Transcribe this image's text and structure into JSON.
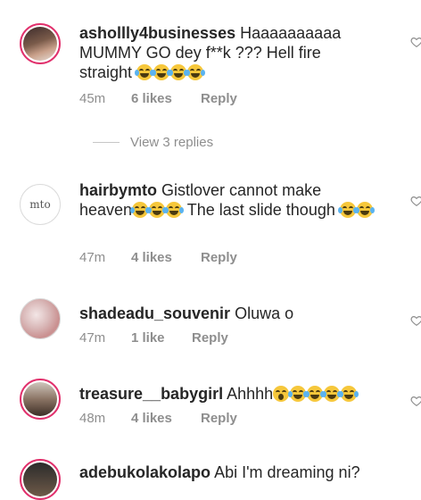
{
  "comments": [
    {
      "username": "ashollly4businesses",
      "text": "Haaaaaaaaaa MUMMY GO dey f**k ??? Hell fire straight",
      "emojis": [
        "joy",
        "joy",
        "joy",
        "joy"
      ],
      "time": "45m",
      "likes": "6 likes",
      "reply": "Reply",
      "view_replies": "View 3 replies"
    },
    {
      "username": "hairbymto",
      "avatar_text": "mto",
      "text_a": "Gistlover cannot make heaven",
      "text_b": "The last slide though",
      "time": "47m",
      "likes": "4 likes",
      "reply": "Reply"
    },
    {
      "username": "shadeadu_souvenir",
      "text": "Oluwa o",
      "time": "47m",
      "likes": "1 like",
      "reply": "Reply"
    },
    {
      "username": "treasure__babygirl",
      "text": "Ahhhh",
      "time": "48m",
      "likes": "4 likes",
      "reply": "Reply"
    },
    {
      "username": "adebukolakolapo",
      "text": "Abi I'm dreaming ni?"
    }
  ],
  "colors": {
    "story_ring": "#e1306c",
    "meta_gray": "#8e8e8e",
    "emoji_yellow": "#f6c73b"
  },
  "icons": {
    "like": "heart-outline-icon"
  }
}
